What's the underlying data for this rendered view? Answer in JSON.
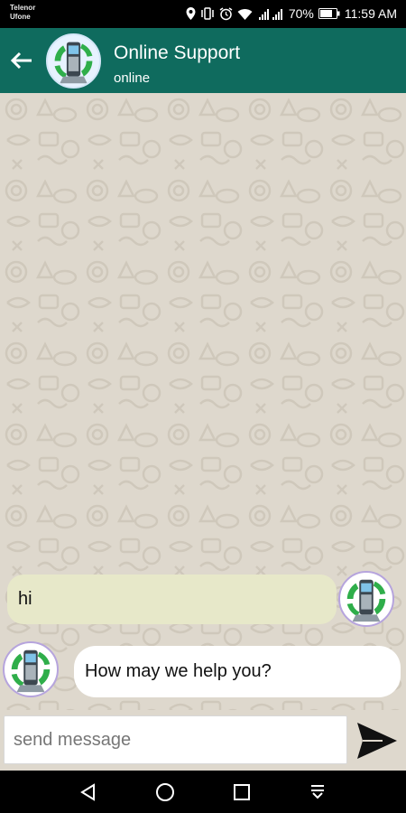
{
  "status_bar": {
    "carrier_line1": "Telenor",
    "carrier_line2": "Ufone",
    "battery": "70%",
    "time": "11:59 AM",
    "icons": [
      "location-icon",
      "vibrate-icon",
      "alarm-icon",
      "wifi-icon",
      "signal-icon",
      "battery-icon"
    ]
  },
  "header": {
    "contact_name": "Online Support",
    "contact_status": "online",
    "back_icon": "back-arrow-icon",
    "avatar_icon": "phone-avatar-icon",
    "color": "#0f6b5e"
  },
  "messages": [
    {
      "direction": "sent",
      "text": "hi",
      "avatar": "phone-avatar-icon"
    },
    {
      "direction": "received",
      "text": "How may we help you?",
      "avatar": "phone-avatar-icon"
    }
  ],
  "composer": {
    "placeholder": "send message",
    "value": "",
    "send_icon": "send-icon"
  },
  "nav_bar": {
    "icons": [
      "back-triangle-icon",
      "home-circle-icon",
      "recents-square-icon",
      "notification-pull-icon"
    ]
  },
  "colors": {
    "chat_background": "#ded8cd",
    "sent_bubble": "#e7e8c9",
    "received_bubble": "#ffffff"
  }
}
